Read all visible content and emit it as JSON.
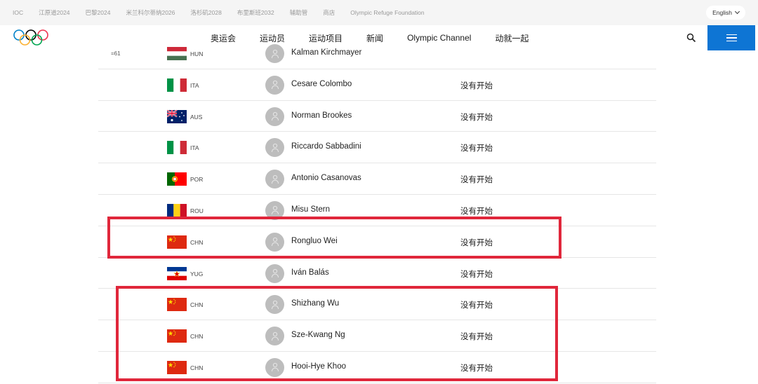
{
  "topbar": {
    "links": [
      "IOC",
      "江原道2024",
      "巴黎2024",
      "米兰科尔蒂纳2026",
      "洛杉矶2028",
      "布里斯班2032",
      "辅助管",
      "商店",
      "Olympic Refuge Foundation"
    ],
    "language": "English"
  },
  "nav": {
    "items": [
      "奥运会",
      "运动员",
      "运动项目",
      "新闻",
      "Olympic Channel",
      "动就一起"
    ]
  },
  "colors": {
    "accent": "#0e75d4",
    "highlight": "#e0273b"
  },
  "results": [
    {
      "rank": "=61",
      "country": "HUN",
      "flag": "hun",
      "name": "Kalman Kirchmayer",
      "status": ""
    },
    {
      "rank": "",
      "country": "ITA",
      "flag": "ita",
      "name": "Cesare Colombo",
      "status": "没有开始"
    },
    {
      "rank": "",
      "country": "AUS",
      "flag": "aus",
      "name": "Norman Brookes",
      "status": "没有开始"
    },
    {
      "rank": "",
      "country": "ITA",
      "flag": "ita",
      "name": "Riccardo Sabbadini",
      "status": "没有开始"
    },
    {
      "rank": "",
      "country": "POR",
      "flag": "por",
      "name": "Antonio Casanovas",
      "status": "没有开始"
    },
    {
      "rank": "",
      "country": "ROU",
      "flag": "rou",
      "name": "Misu Stern",
      "status": "没有开始"
    },
    {
      "rank": "",
      "country": "CHN",
      "flag": "chn",
      "name": "Rongluo Wei",
      "status": "没有开始"
    },
    {
      "rank": "",
      "country": "YUG",
      "flag": "yug",
      "name": "Iván Balás",
      "status": "没有开始"
    },
    {
      "rank": "",
      "country": "CHN",
      "flag": "chn",
      "name": "Shizhang Wu",
      "status": "没有开始"
    },
    {
      "rank": "",
      "country": "CHN",
      "flag": "chn",
      "name": "Sze-Kwang Ng",
      "status": "没有开始"
    },
    {
      "rank": "",
      "country": "CHN",
      "flag": "chn",
      "name": "Hooi-Hye Khoo",
      "status": "没有开始"
    }
  ]
}
